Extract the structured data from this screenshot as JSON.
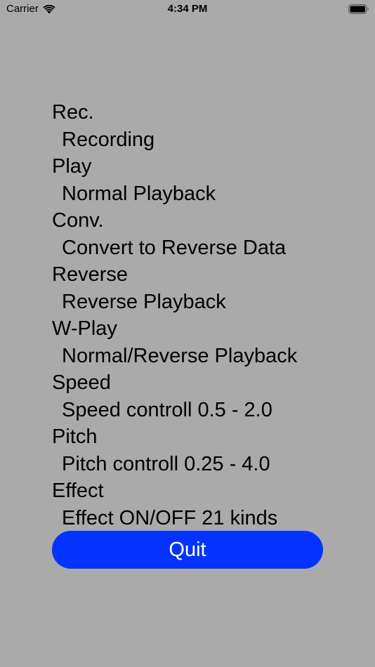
{
  "status_bar": {
    "carrier": "Carrier",
    "time": "4:34 PM",
    "wifi_icon": "wifi-icon",
    "battery_icon": "battery-icon"
  },
  "help": {
    "items": [
      {
        "key": "Rec.",
        "desc": "Recording"
      },
      {
        "key": "Play",
        "desc": "Normal Playback"
      },
      {
        "key": "Conv.",
        "desc": "Convert to Reverse Data"
      },
      {
        "key": "Reverse",
        "desc": "Reverse Playback"
      },
      {
        "key": "W-Play",
        "desc": "Normal/Reverse Playback"
      },
      {
        "key": "Speed",
        "desc": "Speed controll 0.5 - 2.0"
      },
      {
        "key": "Pitch",
        "desc": "Pitch controll 0.25 - 4.0"
      },
      {
        "key": "Effect",
        "desc": "Effect ON/OFF 21 kinds"
      }
    ]
  },
  "quit_label": "Quit",
  "colors": {
    "background": "#aaaaaa",
    "quit_button": "#0433ff",
    "quit_text": "#ffffff"
  }
}
